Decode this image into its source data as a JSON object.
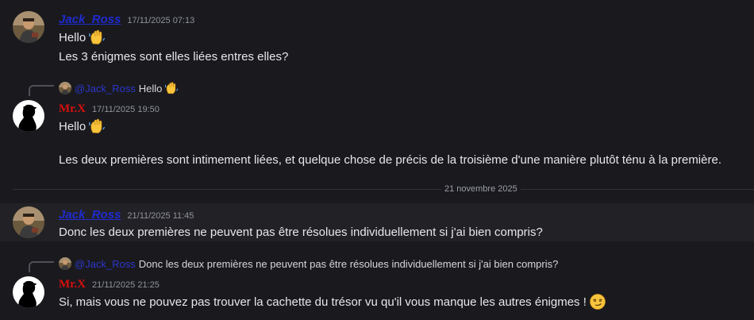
{
  "messages": [
    {
      "author": "Jack_Ross",
      "timestamp": "17/11/2025 07:13",
      "lines": [
        "Hello",
        "Les 3 énigmes sont elles liées entres elles?"
      ]
    },
    {
      "reply": {
        "mention": "@Jack_Ross",
        "text": "Hello"
      },
      "author": "Mr.X",
      "timestamp": "17/11/2025 19:50",
      "lines": [
        "Hello",
        "Les deux premières sont intimement liées, et quelque chose de précis de la troisième d'une manière plutôt ténu à la première."
      ]
    },
    {
      "author": "Jack_Ross",
      "timestamp": "21/11/2025 11:45",
      "lines": [
        "Donc les deux premières ne peuvent pas être résolues individuellement si j'ai bien compris?"
      ]
    },
    {
      "reply": {
        "mention": "@Jack_Ross",
        "text": "Donc les deux premières ne peuvent pas être résolues individuellement si j'ai bien compris?"
      },
      "author": "Mr.X",
      "timestamp": "21/11/2025 21:25",
      "lines": [
        "Si, mais vous ne pouvez pas trouver la cachette du trésor vu qu'il vous manque les autres énigmes !"
      ]
    }
  ],
  "date_divider": "21 novembre 2025",
  "colors": {
    "background": "#1a1a1e",
    "jack_name": "#1f2bd1",
    "mrx_name": "#d60f0f",
    "timestamp": "#8f939b"
  },
  "icons": [
    "waving-hand-emoji",
    "smirking-face-emoji"
  ]
}
